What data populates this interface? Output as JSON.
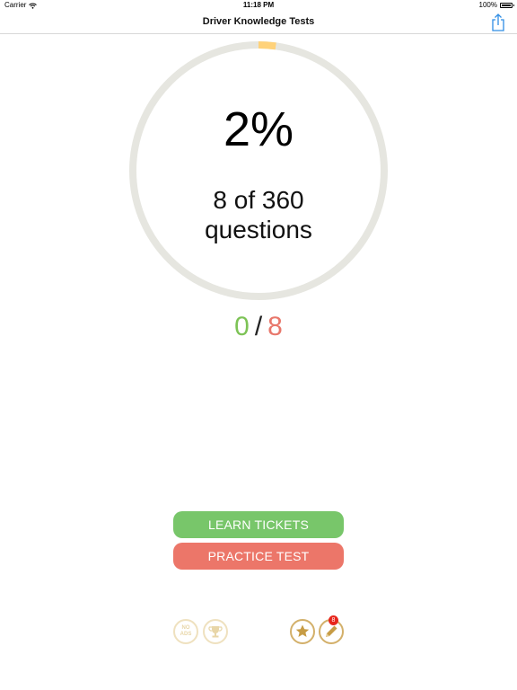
{
  "status_bar": {
    "carrier": "Carrier",
    "time": "11:18 PM",
    "battery": "100%"
  },
  "nav": {
    "title": "Driver Knowledge Tests",
    "share_icon": "share-icon"
  },
  "progress": {
    "percent_label": "2%",
    "count_label": "8 of 360",
    "questions_label": "questions",
    "fraction": 0.022,
    "ring_color": "#e6e6e0",
    "fill_color": "#ffd27a"
  },
  "score": {
    "correct": "0",
    "separator": "/",
    "wrong": "8",
    "correct_color": "#7dc356",
    "wrong_color": "#e8776b"
  },
  "buttons": {
    "learn_label": "LEARN TICKETS",
    "practice_label": "PRACTICE TEST"
  },
  "bottom_bar": {
    "noads_line1": "NO",
    "noads_line2": "ADS",
    "trophy_icon": "trophy-icon",
    "star_icon": "star-icon",
    "pencil_icon": "pencil-icon",
    "pencil_badge": "8"
  }
}
